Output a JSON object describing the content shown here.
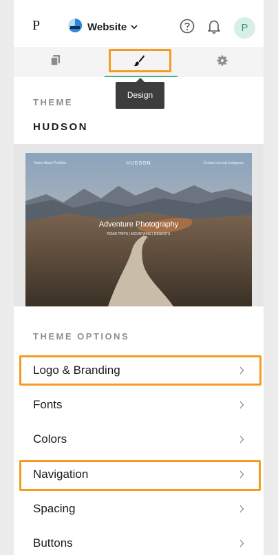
{
  "topbar": {
    "brand_letter": "P",
    "site_name": "Website",
    "avatar_initial": "P"
  },
  "tabs": [
    {
      "name": "pages",
      "icon": "pages-icon",
      "active": false
    },
    {
      "name": "design",
      "icon": "paintbrush-icon",
      "active": true
    },
    {
      "name": "settings",
      "icon": "gear-icon",
      "active": false
    }
  ],
  "tooltip": {
    "text": "Design"
  },
  "theme": {
    "section_label": "THEME",
    "name": "HUDSON",
    "preview": {
      "logo": "HUDSON",
      "nav_left": "Home   About   Portfolio",
      "nav_right": "Contact   Journal   Instagram",
      "hero_title": "Adventure Photography",
      "hero_sub": "ROAD TRIPS  |  MOUNTAINS  |  DESERTS"
    }
  },
  "options": {
    "section_label": "THEME OPTIONS",
    "items": [
      {
        "label": "Logo & Branding",
        "highlighted": true
      },
      {
        "label": "Fonts",
        "highlighted": false
      },
      {
        "label": "Colors",
        "highlighted": false
      },
      {
        "label": "Navigation",
        "highlighted": true
      },
      {
        "label": "Spacing",
        "highlighted": false
      },
      {
        "label": "Buttons",
        "highlighted": false
      }
    ]
  },
  "colors": {
    "accent": "#3fb58c",
    "highlight": "#f59b22",
    "tooltip_bg": "#3d3d3d"
  }
}
